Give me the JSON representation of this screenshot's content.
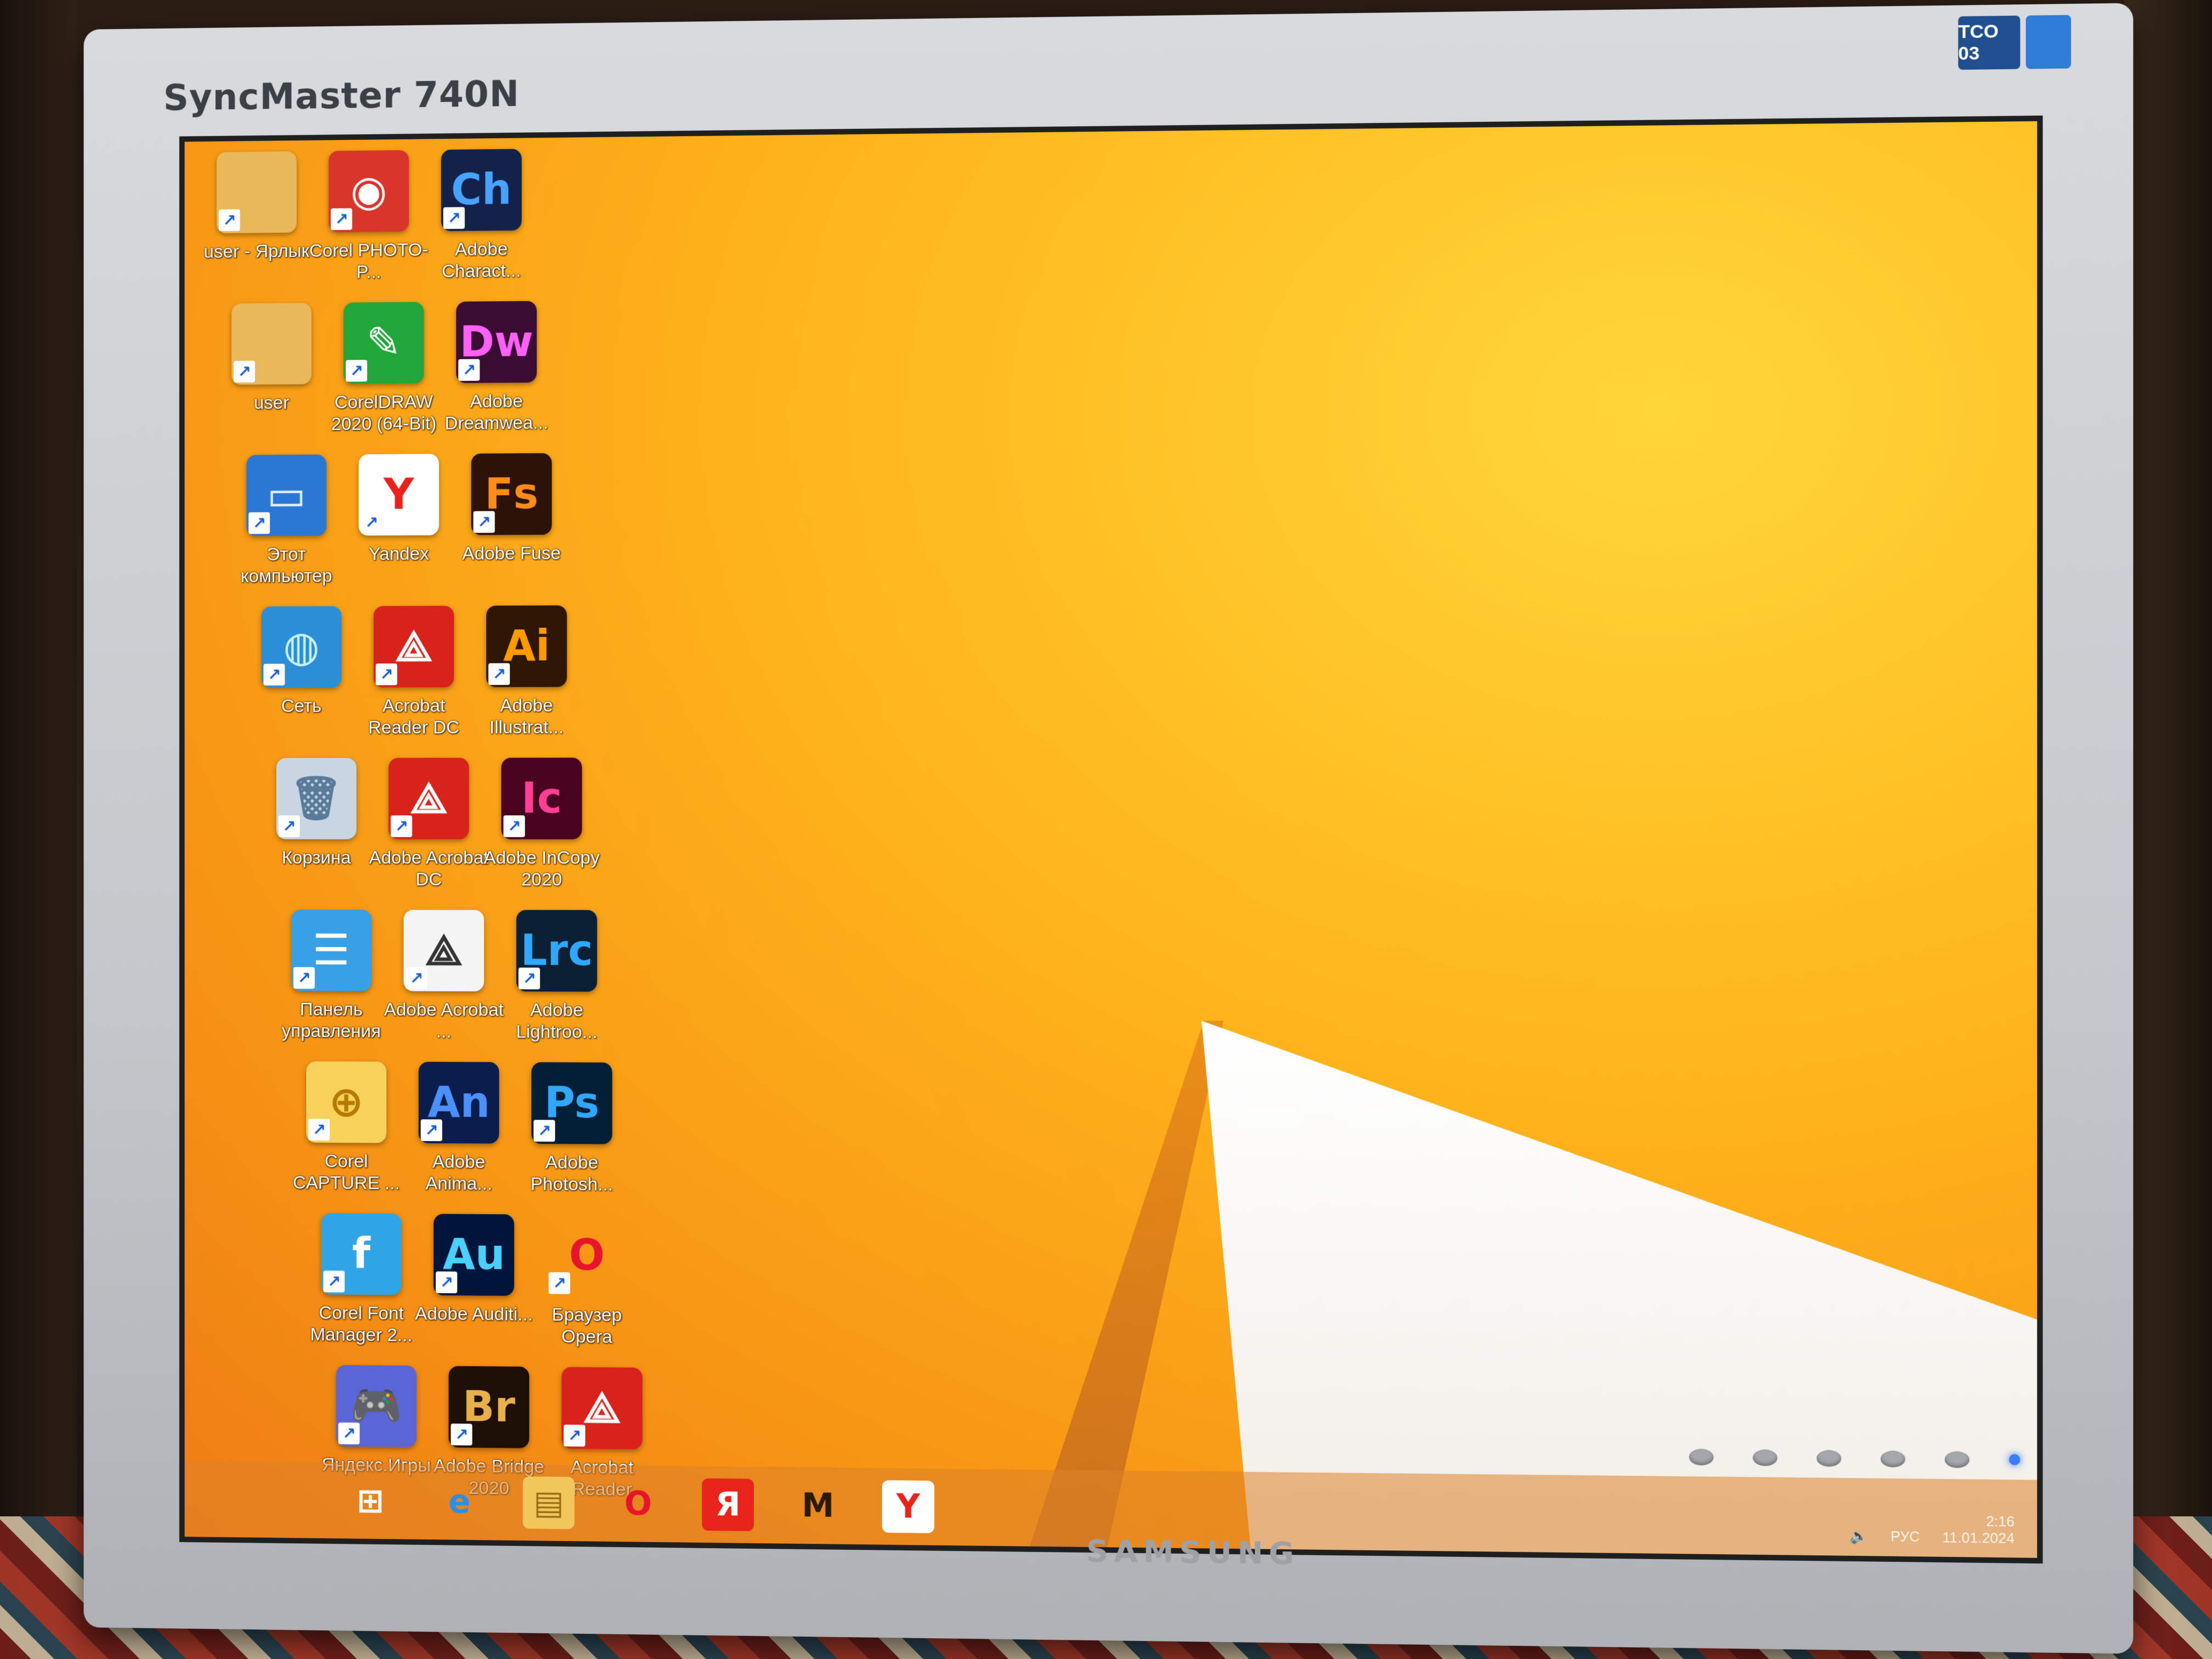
{
  "monitor": {
    "model": "SyncMaster 740N",
    "brand": "SAMSUNG",
    "badge": "TCO 03"
  },
  "desktop": {
    "icons": [
      {
        "label": "user - Ярлык",
        "glyph": "",
        "icon": "folder-user-icon",
        "bg": "#e9b85a",
        "fg": "#5a3b12"
      },
      {
        "label": "Corel PHOTO-P...",
        "glyph": "◉",
        "icon": "corel-photo-paint-icon",
        "bg": "#d9352b",
        "fg": "#ffffff"
      },
      {
        "label": "Adobe Charact...",
        "glyph": "Ch",
        "icon": "adobe-character-animator-icon",
        "bg": "#13224a",
        "fg": "#47a3ff"
      },
      {
        "label": "user",
        "glyph": "",
        "icon": "folder-user-icon",
        "bg": "#e9b85a",
        "fg": "#5a3b12"
      },
      {
        "label": "CorelDRAW 2020 (64-Bit)",
        "glyph": "✎",
        "icon": "coreldraw-icon",
        "bg": "#21a63a",
        "fg": "#ffffff"
      },
      {
        "label": "Adobe Dreamwea...",
        "glyph": "Dw",
        "icon": "adobe-dreamweaver-icon",
        "bg": "#3a0b33",
        "fg": "#ff61f6"
      },
      {
        "label": "Этот компьютер",
        "glyph": "▭",
        "icon": "computer-icon",
        "bg": "#2b78d4",
        "fg": "#dff0ff"
      },
      {
        "label": "Yandex",
        "glyph": "Y",
        "icon": "yandex-browser-icon",
        "bg": "#ffffff",
        "fg": "#e8241a"
      },
      {
        "label": "Adobe Fuse",
        "glyph": "Fs",
        "icon": "adobe-fuse-icon",
        "bg": "#2b1406",
        "fg": "#ff8c1a"
      },
      {
        "label": "Сеть",
        "glyph": "◍",
        "icon": "network-icon",
        "bg": "#2a8fd6",
        "fg": "#c8f0ff"
      },
      {
        "label": "Acrobat Reader DC",
        "glyph": "⟁",
        "icon": "acrobat-reader-icon",
        "bg": "#d8231c",
        "fg": "#ffffff"
      },
      {
        "label": "Adobe Illustrat...",
        "glyph": "Ai",
        "icon": "adobe-illustrator-icon",
        "bg": "#2e1603",
        "fg": "#ff9a00"
      },
      {
        "label": "Корзина",
        "glyph": "🗑",
        "icon": "recycle-bin-icon",
        "bg": "#c8d6e4",
        "fg": "#5a7a9a"
      },
      {
        "label": "Adobe Acrobat DC",
        "glyph": "⟁",
        "icon": "adobe-acrobat-icon",
        "bg": "#d8231c",
        "fg": "#ffffff"
      },
      {
        "label": "Adobe InCopy 2020",
        "glyph": "Ic",
        "icon": "adobe-incopy-icon",
        "bg": "#49021f",
        "fg": "#ff3f94"
      },
      {
        "label": "Панель управления",
        "glyph": "☰",
        "icon": "control-panel-icon",
        "bg": "#38a0e6",
        "fg": "#ffffff"
      },
      {
        "label": "Adobe Acrobat ...",
        "glyph": "⟁",
        "icon": "adobe-acrobat-icon",
        "bg": "#f4f4f4",
        "fg": "#333333"
      },
      {
        "label": "Adobe Lightroo...",
        "glyph": "Lrc",
        "icon": "adobe-lightroom-icon",
        "bg": "#0b1f33",
        "fg": "#31a8ff"
      },
      {
        "label": "Corel CAPTURE ...",
        "glyph": "⊕",
        "icon": "corel-capture-icon",
        "bg": "#f6d25b",
        "fg": "#b67a00"
      },
      {
        "label": "Adobe Anima...",
        "glyph": "An",
        "icon": "adobe-animate-icon",
        "bg": "#0a1e4e",
        "fg": "#4a90ff"
      },
      {
        "label": "Adobe Photosh...",
        "glyph": "Ps",
        "icon": "adobe-photoshop-icon",
        "bg": "#001e36",
        "fg": "#31a8ff"
      },
      {
        "label": "Corel Font Manager 2...",
        "glyph": "f",
        "icon": "corel-font-manager-icon",
        "bg": "#2ea6e6",
        "fg": "#ffffff"
      },
      {
        "label": "Adobe Auditi...",
        "glyph": "Au",
        "icon": "adobe-audition-icon",
        "bg": "#00153a",
        "fg": "#4ad0ff"
      },
      {
        "label": "Браузер Opera",
        "glyph": "O",
        "icon": "opera-browser-icon",
        "bg": "transparent",
        "fg": "#e8132c"
      },
      {
        "label": "Яндекс.Игры",
        "glyph": "🎮",
        "icon": "yandex-games-icon",
        "bg": "#5a66d6",
        "fg": "#ffcc33"
      },
      {
        "label": "Adobe Bridge 2020",
        "glyph": "Br",
        "icon": "adobe-bridge-icon",
        "bg": "#1d0f05",
        "fg": "#e8b04a"
      },
      {
        "label": "Acrobat Reader",
        "glyph": "⟁",
        "icon": "acrobat-reader-icon",
        "bg": "#d8231c",
        "fg": "#ffffff"
      }
    ]
  },
  "taskbar": {
    "items": [
      {
        "icon": "start-button-icon",
        "glyph": "⊞",
        "bg": "transparent",
        "fg": "#ffffff"
      },
      {
        "icon": "internet-explorer-icon",
        "glyph": "e",
        "bg": "transparent",
        "fg": "#2a8fe6"
      },
      {
        "icon": "file-explorer-icon",
        "glyph": "▤",
        "bg": "#f1c75b",
        "fg": "#9b6a14"
      },
      {
        "icon": "opera-browser-icon",
        "glyph": "O",
        "bg": "transparent",
        "fg": "#e8132c"
      },
      {
        "icon": "yandex-icon",
        "glyph": "Я",
        "bg": "#e8241a",
        "fg": "#ffffff"
      },
      {
        "icon": "yandex-music-icon",
        "glyph": "M",
        "bg": "transparent",
        "fg": "#2b1a00"
      },
      {
        "icon": "yandex-browser-icon",
        "glyph": "Y",
        "bg": "#ffffff",
        "fg": "#e8241a"
      }
    ],
    "tray": {
      "language": "РУС",
      "time": "2:16",
      "date": "11.01.2024"
    }
  }
}
